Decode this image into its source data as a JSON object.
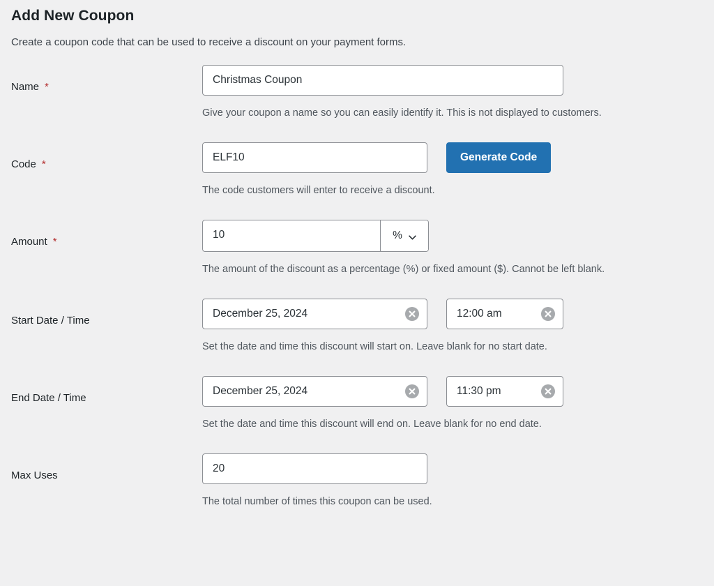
{
  "header": {
    "title": "Add New Coupon",
    "subtitle": "Create a coupon code that can be used to receive a discount on your payment forms."
  },
  "required_marker": "*",
  "colors": {
    "page_background": "#f0f0f1",
    "primary_button": "#2271b1",
    "required_asterisk": "#b32d2e",
    "input_border": "#8c8f94",
    "help_text": "#50575e",
    "label_text": "#1d2327",
    "clear_button": "#a7aaad"
  },
  "fields": {
    "name": {
      "label": "Name",
      "value": "Christmas Coupon",
      "help": "Give your coupon a name so you can easily identify it. This is not displayed to customers."
    },
    "code": {
      "label": "Code",
      "value": "ELF10",
      "button_label": "Generate Code",
      "help": "The code customers will enter to receive a discount."
    },
    "amount": {
      "label": "Amount",
      "value": "10",
      "unit": "%",
      "unit_options": [
        "%",
        "$"
      ],
      "help": "The amount of the discount as a percentage (%) or fixed amount ($). Cannot be left blank."
    },
    "start": {
      "label": "Start Date / Time",
      "date_value": "December 25, 2024",
      "time_value": "12:00 am",
      "help": "Set the date and time this discount will start on. Leave blank for no start date."
    },
    "end": {
      "label": "End Date / Time",
      "date_value": "December 25, 2024",
      "time_value": "11:30 pm",
      "help": "Set the date and time this discount will end on. Leave blank for no end date."
    },
    "max_uses": {
      "label": "Max Uses",
      "value": "20",
      "help": "The total number of times this coupon can be used."
    }
  },
  "icons": {
    "clear": "clear-circle-icon",
    "chevron": "chevron-down-icon"
  }
}
